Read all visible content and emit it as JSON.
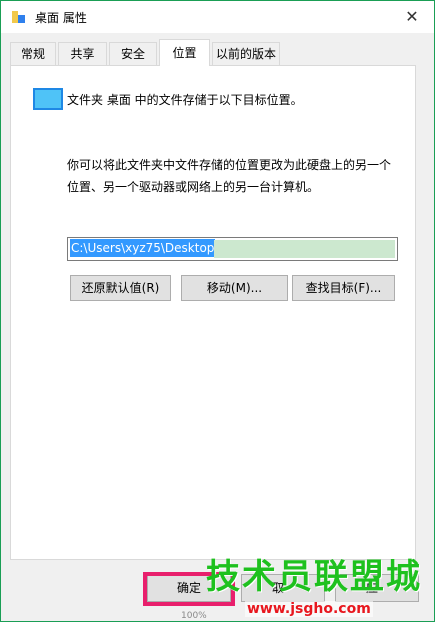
{
  "window": {
    "title": "桌面 属性",
    "close_label": "✕"
  },
  "tabs": [
    {
      "label": "常规"
    },
    {
      "label": "共享"
    },
    {
      "label": "安全"
    },
    {
      "label": "位置",
      "active": true
    },
    {
      "label": "以前的版本"
    }
  ],
  "location": {
    "info_text": "文件夹 桌面 中的文件存储于以下目标位置。",
    "description_line1": "你可以将此文件夹中文件存储的位置更改为此硬盘上的另一个",
    "description_line2": "位置、另一个驱动器或网络上的另一台计算机。",
    "path_value": "C:\\Users\\xyz75\\Desktop",
    "restore_default_label": "还原默认值(R)",
    "move_label": "移动(M)...",
    "find_target_label": "查找目标(F)..."
  },
  "footer": {
    "ok_label": "确定",
    "cancel_label": "取",
    "apply_label": "应"
  },
  "watermark": {
    "brand": "技术员联盟",
    "url": "www.jsgho.com",
    "extra": "城"
  },
  "hint": "100%"
}
